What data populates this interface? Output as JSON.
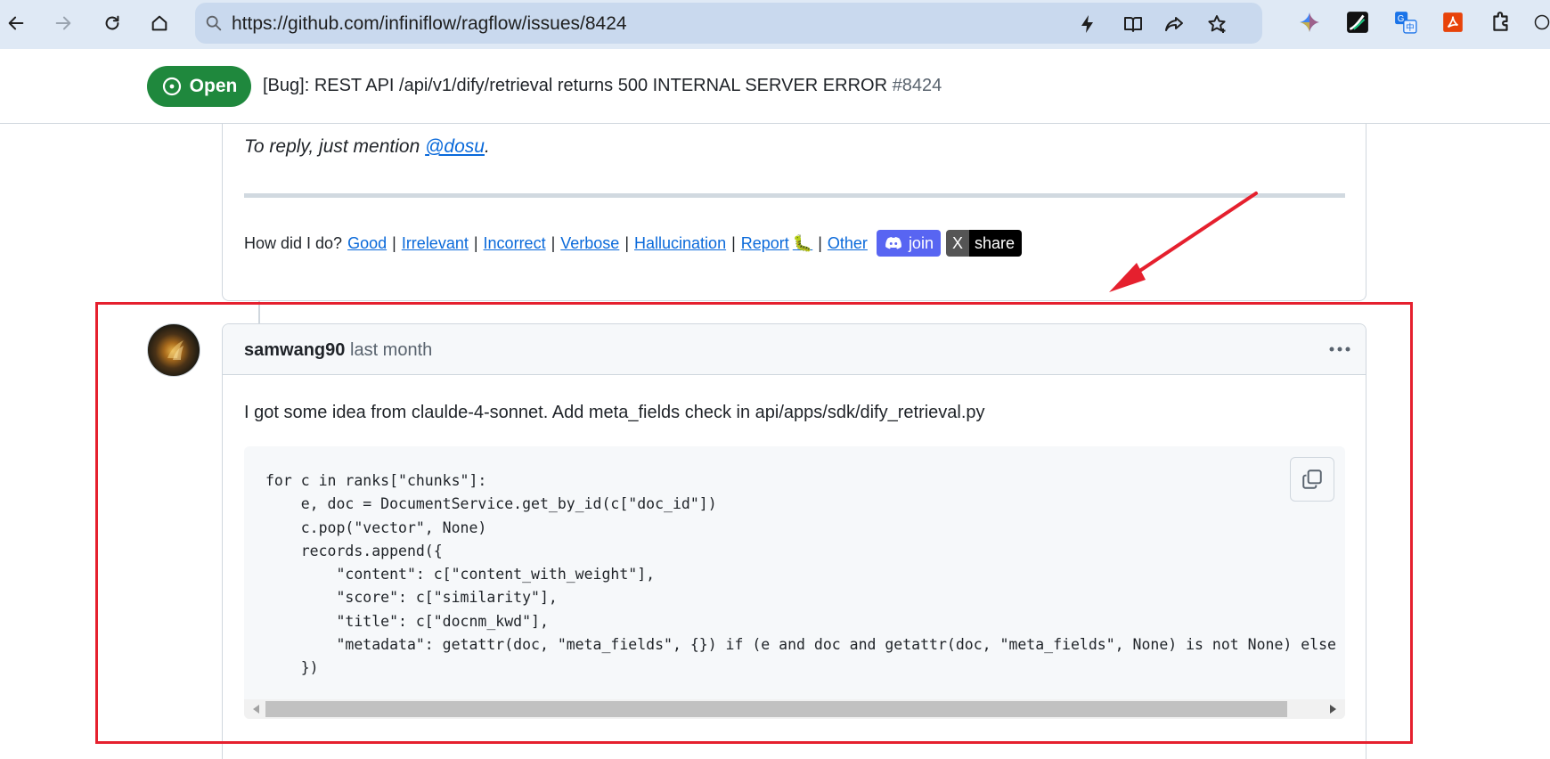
{
  "browser": {
    "url": "https://github.com/infiniflow/ragflow/issues/8424",
    "toolbar_icons": [
      "back-icon",
      "forward-icon",
      "reload-icon",
      "home-icon"
    ],
    "address_icons": [
      "lightning-icon",
      "reader-mode-icon",
      "share-icon",
      "bookmark-star-icon"
    ],
    "extension_icons": [
      "ai-sparkle-icon",
      "pen-extension-icon",
      "translate-icon",
      "pdf-icon",
      "extensions-puzzle-icon"
    ]
  },
  "issue": {
    "state": "Open",
    "title": "[Bug]: REST API /api/v1/dify/retrieval returns 500 INTERNAL SERVER ERROR",
    "number": "#8424"
  },
  "previous_comment": {
    "reply_prefix": "To reply, just mention ",
    "reply_mention": "@dosu",
    "reply_suffix": ".",
    "feedback_prompt": "How did I do?",
    "feedback_links": [
      "Good",
      "Irrelevant",
      "Incorrect",
      "Verbose",
      "Hallucination",
      "Report",
      "Other"
    ],
    "report_glyph": "🐛",
    "discord_label": "join",
    "x_left_label": "X",
    "x_right_label": "share",
    "separator": "|"
  },
  "comment": {
    "author": "samwang90",
    "timestamp": "last month",
    "body": "I got some idea from claulde-4-sonnet. Add meta_fields check in api/apps/sdk/dify_retrieval.py",
    "code": "for c in ranks[\"chunks\"]:\n    e, doc = DocumentService.get_by_id(c[\"doc_id\"])\n    c.pop(\"vector\", None)\n    records.append({\n        \"content\": c[\"content_with_weight\"],\n        \"score\": c[\"similarity\"],\n        \"title\": c[\"docnm_kwd\"],\n        \"metadata\": getattr(doc, \"meta_fields\", {}) if (e and doc and getattr(doc, \"meta_fields\", None) is not None) else {}\n    })"
  },
  "colors": {
    "open_green": "#1f883d",
    "link_blue": "#0969da",
    "annotation_red": "#e5202e",
    "discord_blurple": "#5865f2"
  }
}
